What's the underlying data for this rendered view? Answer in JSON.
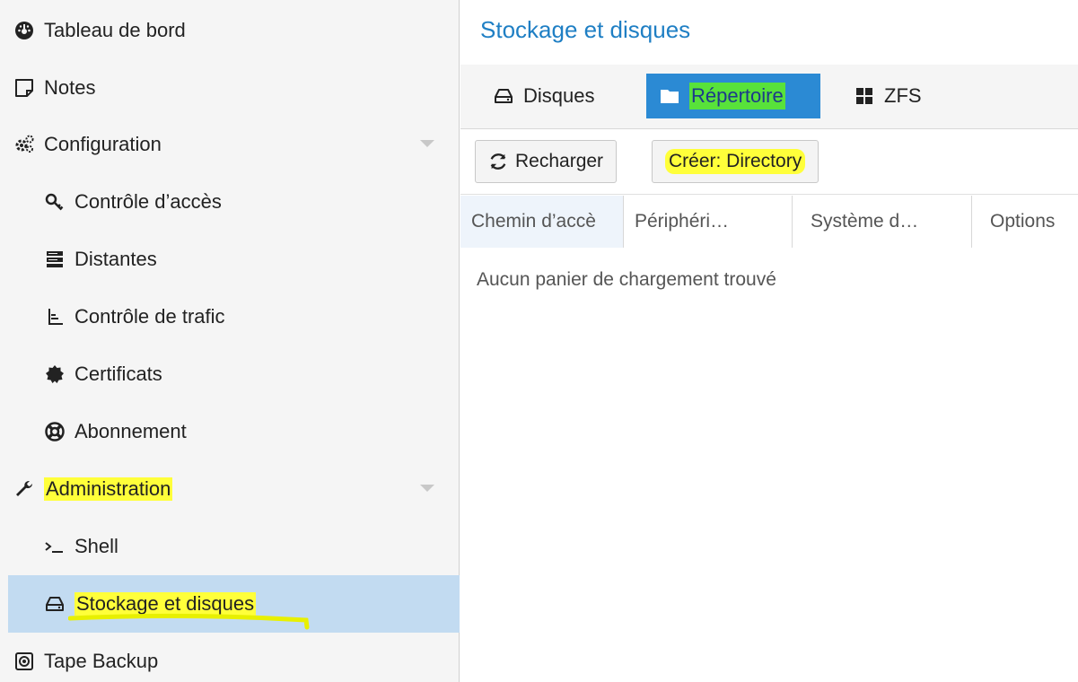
{
  "sidebar": {
    "items": [
      {
        "label": "Tableau de bord",
        "icon": "dashboard-icon"
      },
      {
        "label": "Notes",
        "icon": "note-icon"
      },
      {
        "label": "Configuration",
        "icon": "gears-icon"
      },
      {
        "label": "Contrôle d’accès",
        "icon": "key-icon"
      },
      {
        "label": "Distantes",
        "icon": "server-icon"
      },
      {
        "label": "Contrôle de trafic",
        "icon": "traffic-control-icon"
      },
      {
        "label": "Certificats",
        "icon": "certificate-icon"
      },
      {
        "label": "Abonnement",
        "icon": "life-ring-icon"
      },
      {
        "label": "Administration",
        "icon": "wrench-icon"
      },
      {
        "label": "Shell",
        "icon": "terminal-icon"
      },
      {
        "label": "Stockage et disques",
        "icon": "hdd-icon"
      },
      {
        "label": "Tape Backup",
        "icon": "tape-icon"
      }
    ]
  },
  "main": {
    "title": "Stockage et disques",
    "tabs": [
      {
        "label": "Disques",
        "icon": "hdd-icon"
      },
      {
        "label": "Répertoire",
        "icon": "folder-icon"
      },
      {
        "label": "ZFS",
        "icon": "grid-icon"
      }
    ],
    "toolbar": {
      "reload_label": "Recharger",
      "create_label": "Créer: Directory"
    },
    "columns": [
      "Chemin d’accè",
      "Périphéri…",
      "Système d…",
      "Options"
    ],
    "empty_text": "Aucun panier de chargement trouvé"
  },
  "colors": {
    "accent": "#1f7fc4",
    "active_tab": "#2b8ad4",
    "selected_row": "#c2dbf1",
    "highlight": "#ffff3a"
  }
}
